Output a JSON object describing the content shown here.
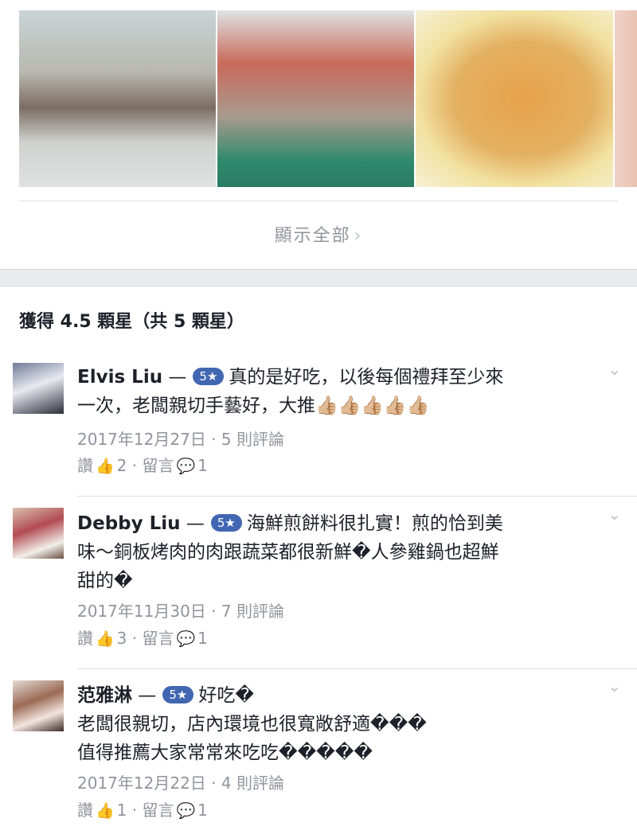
{
  "photos": [
    "restaurant-interior-photo",
    "kitchen-prep-photo",
    "pancake-dish-photo"
  ],
  "show_all": {
    "label": "顯示全部",
    "icon": "chevron-right-icon"
  },
  "rating_summary": "獲得 4.5 顆星（共 5 顆星）",
  "reviews": [
    {
      "name": "Elvis Liu",
      "dash": " —",
      "rating": "5★",
      "text_1": "真的是好吃，以後每個禮拜至少來",
      "text_2": "一次，老闆親切手藝好，大推",
      "emoji": "👍🏼👍🏼👍🏼👍🏼👍🏼",
      "meta": "2017年12月27日 · 5 則評論",
      "like_label": "讚",
      "like_count": "2",
      "comment_label": "留言",
      "comment_count": "1"
    },
    {
      "name": "Debby Liu",
      "dash": " —",
      "rating": "5★",
      "text_1": "海鮮煎餅料很扎實！煎的恰到美",
      "text_2": "味～銅板烤肉的肉跟蔬菜都很新鮮�人參雞鍋也超鮮",
      "text_3": "甜的�",
      "meta": "2017年11月30日 · 7 則評論",
      "like_label": "讚",
      "like_count": "3",
      "comment_label": "留言",
      "comment_count": "1"
    },
    {
      "name": "范雅淋",
      "dash": " —",
      "rating": "5★",
      "text_1": "好吃�",
      "text_2": "老闆很親切，店內環境也很寬敞舒適���",
      "text_3": "值得推薦大家常常來吃吃�����",
      "meta": "2017年12月22日 · 4 則評論",
      "like_label": "讚",
      "like_count": "1",
      "comment_label": "留言",
      "comment_count": "1"
    }
  ]
}
